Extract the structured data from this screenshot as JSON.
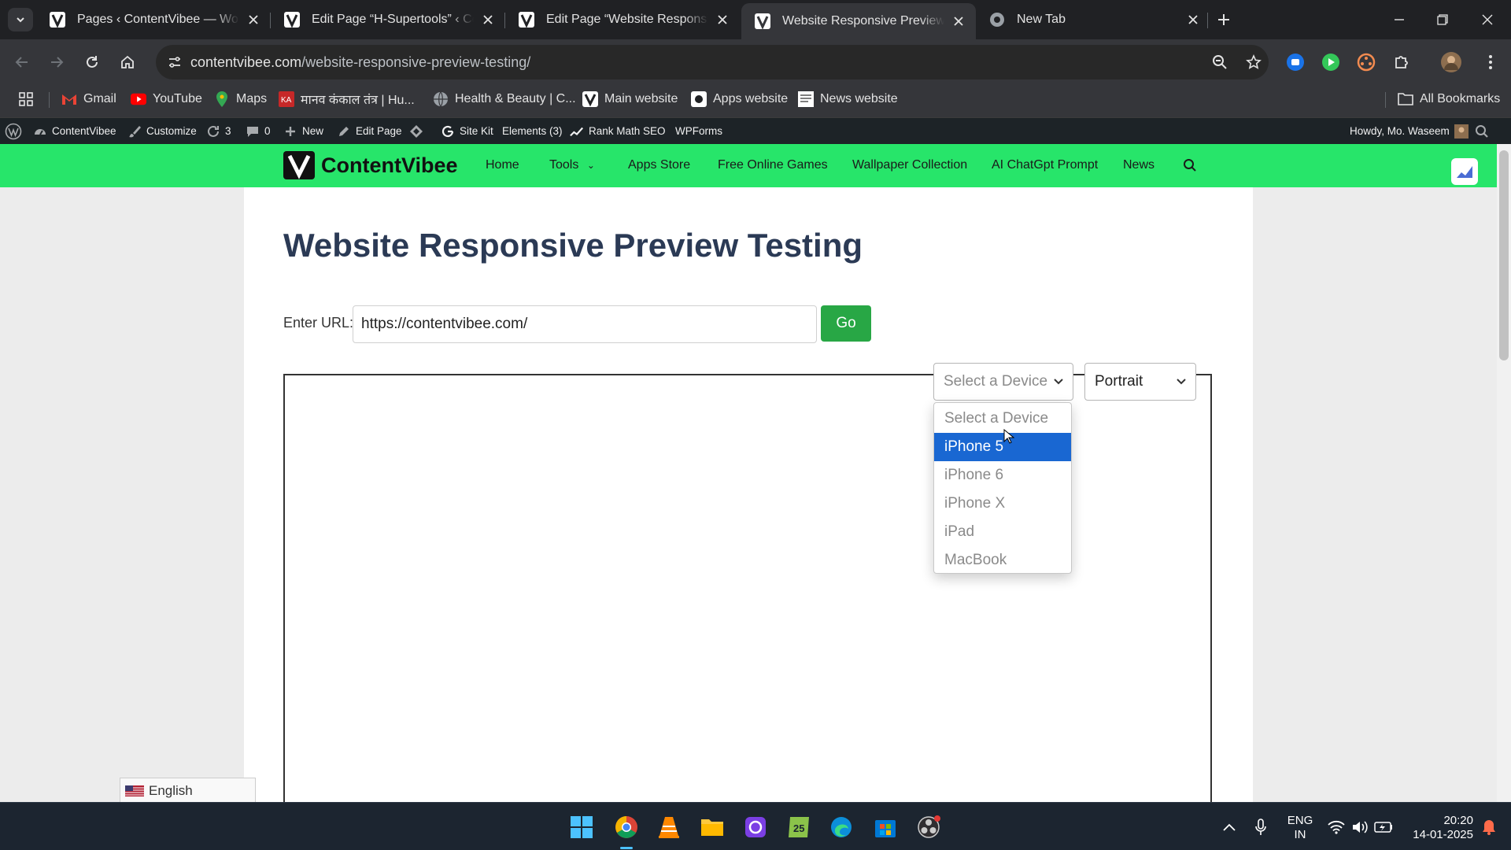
{
  "browser": {
    "tabs": [
      {
        "title": "Pages ‹ ContentVibee — WordPress",
        "active": false
      },
      {
        "title": "Edit Page “H-Supertools” ‹ ContentVibee",
        "active": false
      },
      {
        "title": "Edit Page “Website Responsive Preview",
        "active": false
      },
      {
        "title": "Website Responsive Preview Testing",
        "active": true
      },
      {
        "title": "New Tab",
        "active": false
      }
    ],
    "address": {
      "domain": "contentvibee.com",
      "path": "/website-responsive-preview-testing/"
    },
    "bookmarks": [
      "Gmail",
      "YouTube",
      "Maps",
      "मानव कंकाल तंत्र | Hu...",
      "Health & Beauty | C...",
      "Main website",
      "Apps website",
      "News website"
    ],
    "all_bookmarks": "All Bookmarks"
  },
  "wp_admin_bar": {
    "site": "ContentVibee",
    "customize": "Customize",
    "updates": "3",
    "comments": "0",
    "new": "New",
    "edit_page": "Edit Page",
    "site_kit": "Site Kit",
    "elements": "Elements (3)",
    "rank_math": "Rank Math SEO",
    "wpforms": "WPForms",
    "howdy": "Howdy, Mo. Waseem"
  },
  "site": {
    "logo": "ContentVibee",
    "nav": [
      "Home",
      "Tools",
      "Apps Store",
      "Free Online Games",
      "Wallpaper Collection",
      "AI ChatGpt Prompt",
      "News"
    ],
    "accent": "#27e56a"
  },
  "page": {
    "title": "Website Responsive Preview Testing",
    "url_label": "Enter URL:",
    "url_value": "https://contentvibee.com/",
    "go_label": "Go",
    "device_select": "Select a Device",
    "orientation_select": "Portrait",
    "device_options": [
      "Select a Device",
      "iPhone 5",
      "iPhone 6",
      "iPhone X",
      "iPad",
      "MacBook"
    ],
    "highlighted_option": "iPhone 5",
    "language": "English"
  },
  "taskbar": {
    "lang_top": "ENG",
    "lang_bottom": "IN",
    "time": "20:20",
    "date": "14-01-2025"
  }
}
